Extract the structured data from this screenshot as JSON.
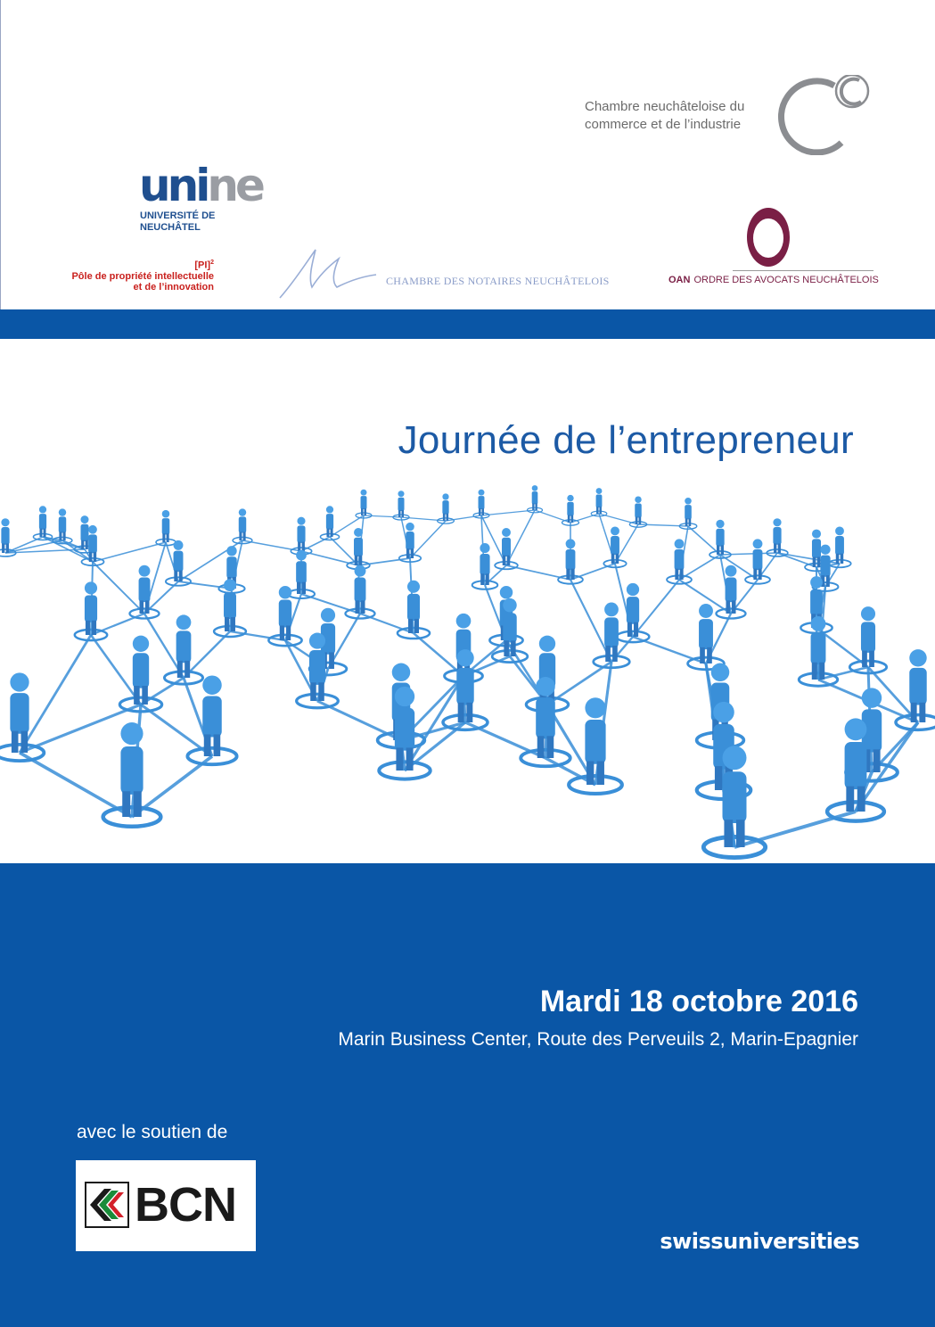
{
  "logos": {
    "cnci": {
      "line1": "Chambre neuchâteloise du",
      "line2": "commerce et de l’industrie"
    },
    "unine": {
      "word_part1": "uni",
      "word_part2": "ne",
      "line1": "UNIVERSITÉ DE",
      "line2": "NEUCHÂTEL",
      "color_primary": "#1f4f8f",
      "color_secondary": "#9a9da3"
    },
    "pi": {
      "badge": "[PI]",
      "badge_sup": "2",
      "line1": "Pôle de propriété intellectuelle",
      "line2": "et de l’innovation",
      "color": "#c9211e"
    },
    "notaires": {
      "text": "CHAMBRE DES NOTAIRES NEUCHÂTELOIS"
    },
    "oan": {
      "abbr": "OAN",
      "text": "ORDRE DES AVOCATS NEUCHÂTELOIS",
      "color": "#7a1f45"
    }
  },
  "title": "Journée de l’entrepreneur",
  "event": {
    "date": "Mardi 18 octobre 2016",
    "place": "Marin Business Center, Route des Perveuils 2, Marin-Epagnier"
  },
  "support": {
    "label": "avec le soutien de",
    "sponsor": "BCN"
  },
  "partner": "swissuniversities",
  "colors": {
    "brand_blue": "#0a56a6",
    "title_blue": "#1c5aa5",
    "figure_blue": "#3a8fd8"
  }
}
